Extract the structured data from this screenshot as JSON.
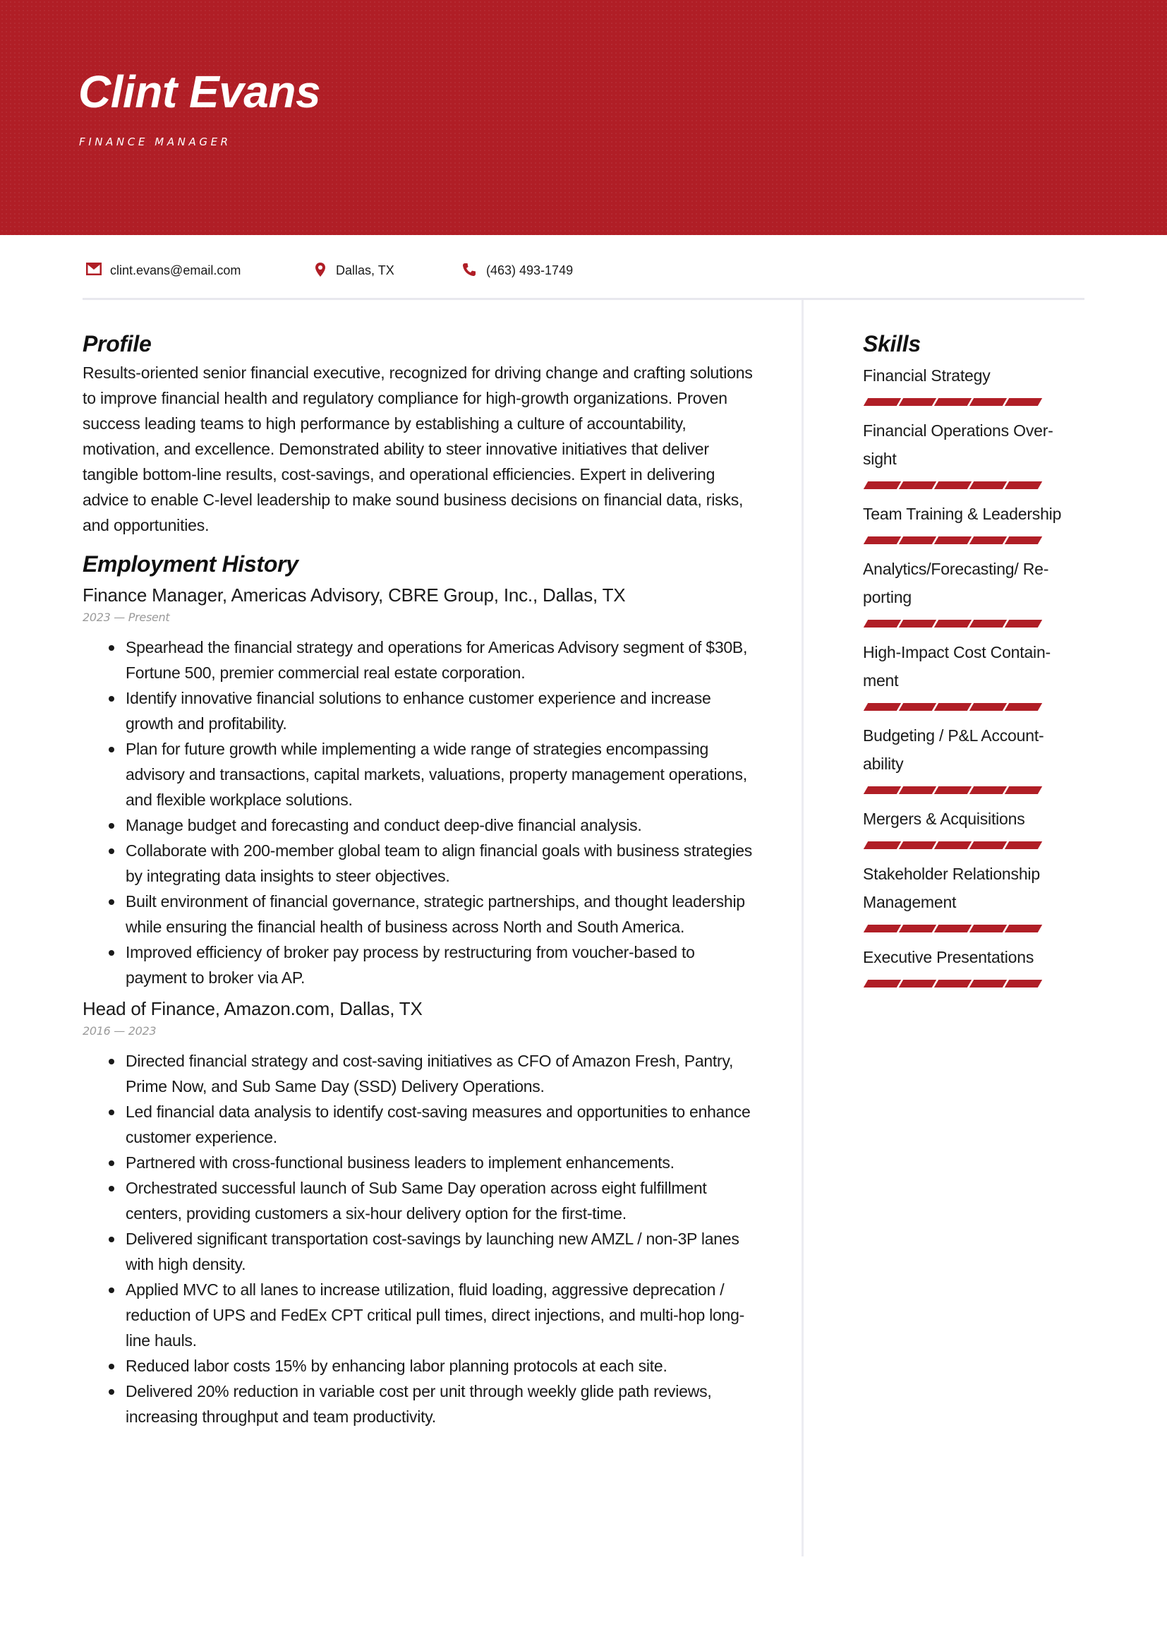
{
  "header": {
    "name": "Clint Evans",
    "title": "FINANCE MANAGER",
    "accent_color": "#b01e26"
  },
  "contact": {
    "email": {
      "icon": "envelope-icon",
      "value": "clint.evans@email.com"
    },
    "location": {
      "icon": "map-pin-icon",
      "value": "Dallas, TX"
    },
    "phone": {
      "icon": "phone-icon",
      "value": "(463) 493-1749"
    }
  },
  "profile": {
    "heading": "Profile",
    "text": "Results-oriented senior financial executive, recognized for driving change and crafting solutions to improve financial health and regulatory compliance for high-growth organizations. Proven success leading teams to high performance by establishing a culture of accountability, motivation, and excellence. Demonstrated ability to steer innovative initiatives that deliver tangible bottom-line results, cost-savings, and operational efficiencies. Expert in delivering advice to enable C-level leadership to make sound business decisions on financial data, risks, and opportunities."
  },
  "employment": {
    "heading": "Employment History",
    "jobs": [
      {
        "title": "Finance Manager, Americas Advisory, CBRE Group, Inc., Dallas, TX",
        "dates": "2023 — Present",
        "bullets": [
          "Spearhead the financial strategy and operations for Americas Advisory segment of $30B, Fortune 500, premier commercial real estate corporation.",
          "Identify innovative financial solutions to enhance customer experience and increase growth and profitability.",
          "Plan for future growth while implementing a wide range of strategies encompassing advisory and transactions, capital markets, valuations, property management operations, and flexible workplace solutions.",
          "Manage budget and forecasting and conduct deep-dive financial analysis.",
          "Collaborate with 200-member global team to align financial goals with business strategies by integrating data insights to steer objectives.",
          "Built environment of financial governance, strategic partnerships, and thought leadership while ensuring the financial health of business across North and South America.",
          "Improved efficiency of broker pay process by restructuring from voucher-based to payment to broker via AP."
        ]
      },
      {
        "title": "Head of Finance, Amazon.com, Dallas, TX",
        "dates": "2016 — 2023",
        "bullets": [
          "Directed financial strategy and cost-saving initiatives as CFO of Amazon Fresh, Pantry, Prime Now, and Sub Same Day (SSD) Delivery Operations.",
          "Led financial data analysis to identify cost-saving measures and opportunities to enhance customer experience.",
          "Partnered with cross-functional business leaders to implement enhancements.",
          "Orchestrated successful launch of Sub Same Day operation across eight fulfillment centers, providing customers a six-hour delivery option for the first-time.",
          "Delivered significant transportation cost-savings by launching new AMZL / non-3P lanes with high density.",
          "Applied MVC to all lanes to increase utilization, fluid loading, aggressive deprecation / reduction of UPS and FedEx CPT critical pull times, direct injections, and multi-hop long-line hauls.",
          "Reduced labor costs 15% by enhancing labor planning protocols at each site.",
          "Delivered 20% reduction in variable cost per unit through weekly glide path reviews, increasing throughput and team productivity."
        ]
      }
    ]
  },
  "skills": {
    "heading": "Skills",
    "max_level": 5,
    "items": [
      {
        "name": "Financial Strategy",
        "level": 5
      },
      {
        "name": "Financial Operations Over-sight",
        "level": 5
      },
      {
        "name": "Team Training & Leadership",
        "level": 5
      },
      {
        "name": "Analytics/Forecasting/ Re-porting",
        "level": 5
      },
      {
        "name": "High-Impact Cost Contain-ment",
        "level": 5
      },
      {
        "name": "Budgeting / P&L Account-ability",
        "level": 5
      },
      {
        "name": "Mergers & Acquisitions",
        "level": 5
      },
      {
        "name": "Stakeholder Relationship Management",
        "level": 5
      },
      {
        "name": "Executive Presentations",
        "level": 5
      }
    ]
  }
}
